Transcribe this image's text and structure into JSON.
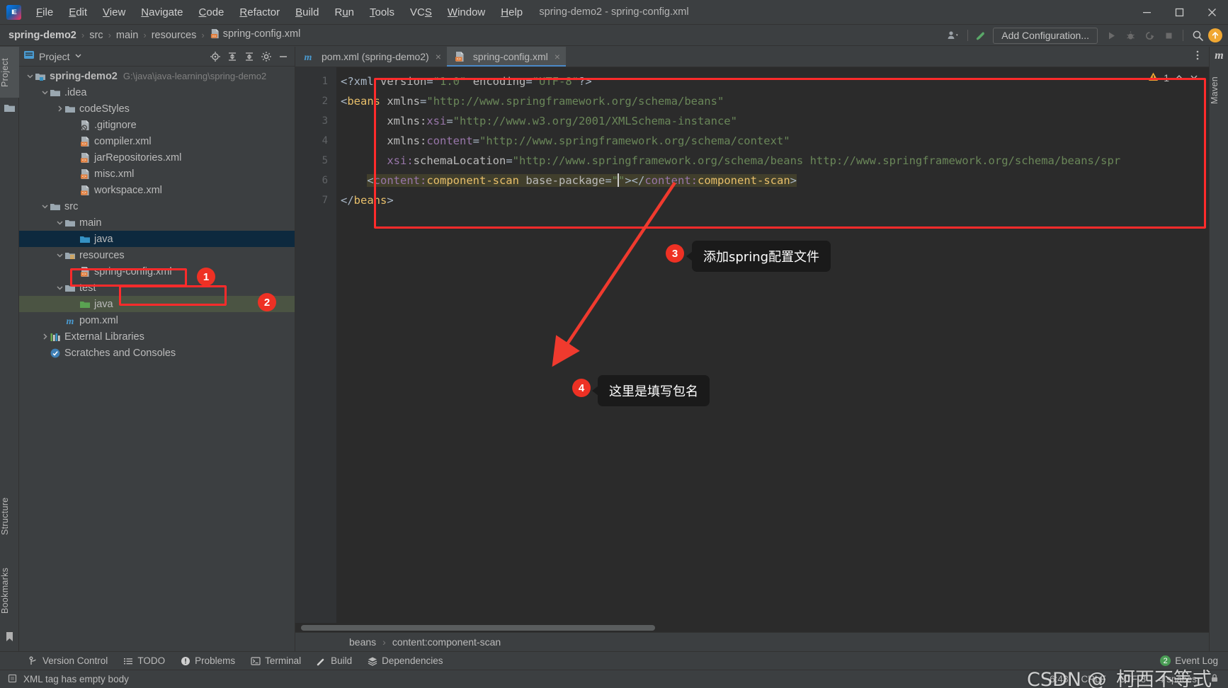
{
  "window": {
    "title": "spring-demo2 - spring-config.xml",
    "logo_text": "IE",
    "minimize_icon": "minimize-icon",
    "maximize_icon": "maximize-icon",
    "close_icon": "close-icon"
  },
  "menubar": {
    "items": [
      {
        "label": "File",
        "mnemonic": "F"
      },
      {
        "label": "Edit",
        "mnemonic": "E"
      },
      {
        "label": "View",
        "mnemonic": "V"
      },
      {
        "label": "Navigate",
        "mnemonic": "N"
      },
      {
        "label": "Code",
        "mnemonic": "C"
      },
      {
        "label": "Refactor",
        "mnemonic": "R"
      },
      {
        "label": "Build",
        "mnemonic": "B"
      },
      {
        "label": "Run",
        "mnemonic": "u"
      },
      {
        "label": "Tools",
        "mnemonic": "T"
      },
      {
        "label": "VCS",
        "mnemonic": "S"
      },
      {
        "label": "Window",
        "mnemonic": "W"
      },
      {
        "label": "Help",
        "mnemonic": "H"
      }
    ]
  },
  "navbar": {
    "breadcrumbs": [
      "spring-demo2",
      "src",
      "main",
      "resources",
      "spring-config.xml"
    ],
    "separator": "›",
    "add_configuration_label": "Add Configuration...",
    "icons": [
      "user-settings-icon",
      "hammer-build-icon",
      "run-icon",
      "debug-icon",
      "run-coverage-icon",
      "stop-icon",
      "search-icon",
      "update-arrow-icon"
    ]
  },
  "left_strip": {
    "tabs": [
      {
        "label": "Project",
        "icon": "project-folder-icon",
        "active": true
      },
      {
        "label": "Structure",
        "icon": "structure-icon",
        "active": false
      },
      {
        "label": "Bookmarks",
        "icon": "bookmark-icon",
        "active": false
      }
    ]
  },
  "right_strip": {
    "tabs": [
      {
        "label": "Maven",
        "icon": "maven-m-icon"
      }
    ]
  },
  "project_panel": {
    "title": "Project",
    "icons": [
      "project-icon",
      "chevron-down-icon",
      "locate-icon",
      "expand-all-icon",
      "collapse-all-icon",
      "gear-icon",
      "hide-icon"
    ],
    "tree": [
      {
        "depth": 0,
        "label": "spring-demo2",
        "path": "G:\\java\\java-learning\\spring-demo2",
        "icon": "module-icon",
        "arrow": "down",
        "bold": true,
        "state": "none"
      },
      {
        "depth": 1,
        "label": ".idea",
        "icon": "folder-icon",
        "arrow": "down",
        "bold": false,
        "state": "none"
      },
      {
        "depth": 2,
        "label": "codeStyles",
        "icon": "folder-icon",
        "arrow": "right",
        "bold": false,
        "state": "none"
      },
      {
        "depth": 3,
        "label": ".gitignore",
        "icon": "gitignore-file-icon",
        "arrow": "none",
        "bold": false,
        "state": "none"
      },
      {
        "depth": 3,
        "label": "compiler.xml",
        "icon": "xml-file-icon",
        "arrow": "none",
        "bold": false,
        "state": "none"
      },
      {
        "depth": 3,
        "label": "jarRepositories.xml",
        "icon": "xml-file-icon",
        "arrow": "none",
        "bold": false,
        "state": "none"
      },
      {
        "depth": 3,
        "label": "misc.xml",
        "icon": "xml-file-icon",
        "arrow": "none",
        "bold": false,
        "state": "none"
      },
      {
        "depth": 3,
        "label": "workspace.xml",
        "icon": "xml-file-icon",
        "arrow": "none",
        "bold": false,
        "state": "none"
      },
      {
        "depth": 1,
        "label": "src",
        "icon": "folder-icon",
        "arrow": "down",
        "bold": false,
        "state": "none"
      },
      {
        "depth": 2,
        "label": "main",
        "icon": "folder-icon",
        "arrow": "down",
        "bold": false,
        "state": "none"
      },
      {
        "depth": 3,
        "label": "java",
        "icon": "source-folder-icon",
        "arrow": "none",
        "bold": false,
        "state": "sel-blue"
      },
      {
        "depth": 2,
        "label": "resources",
        "icon": "resource-folder-icon",
        "arrow": "down",
        "bold": false,
        "state": "none"
      },
      {
        "depth": 3,
        "label": "spring-config.xml",
        "icon": "xml-file-icon",
        "arrow": "none",
        "bold": false,
        "state": "none"
      },
      {
        "depth": 2,
        "label": "test",
        "icon": "folder-icon",
        "arrow": "down",
        "bold": false,
        "state": "none"
      },
      {
        "depth": 3,
        "label": "java",
        "icon": "test-source-folder-icon",
        "arrow": "none",
        "bold": false,
        "state": "sel-green"
      },
      {
        "depth": 2,
        "label": "pom.xml",
        "icon": "maven-pom-icon",
        "arrow": "none",
        "bold": false,
        "state": "none"
      },
      {
        "depth": 1,
        "label": "External Libraries",
        "icon": "libraries-icon",
        "arrow": "right",
        "bold": false,
        "state": "none"
      },
      {
        "depth": 1,
        "label": "Scratches and Consoles",
        "icon": "scratches-icon",
        "arrow": "none",
        "bold": false,
        "state": "none"
      }
    ]
  },
  "editor": {
    "tabs": [
      {
        "label": "pom.xml (spring-demo2)",
        "icon": "maven-pom-icon",
        "active": false,
        "closable": true
      },
      {
        "label": "spring-config.xml",
        "icon": "xml-file-icon",
        "active": true,
        "closable": true
      }
    ],
    "more_icon": "more-vertical-icon",
    "inspection": {
      "icon": "warning-triangle-icon",
      "count": "1",
      "up_icon": "chevron-up-icon",
      "down_icon": "chevron-down-icon"
    },
    "line_numbers": [
      "1",
      "2",
      "3",
      "4",
      "5",
      "6",
      "7"
    ],
    "lines": [
      [
        {
          "t": "punc",
          "s": "<?xml "
        },
        {
          "t": "attr",
          "s": "version"
        },
        {
          "t": "punc",
          "s": "="
        },
        {
          "t": "val",
          "s": "\"1.0\""
        },
        {
          "t": "punc",
          "s": " "
        },
        {
          "t": "attr",
          "s": "encoding"
        },
        {
          "t": "punc",
          "s": "="
        },
        {
          "t": "val",
          "s": "\"UTF-8\""
        },
        {
          "t": "punc",
          "s": "?>"
        }
      ],
      [
        {
          "t": "punc",
          "s": "<"
        },
        {
          "t": "tag",
          "s": "beans"
        },
        {
          "t": "punc",
          "s": " "
        },
        {
          "t": "attr",
          "s": "xmlns"
        },
        {
          "t": "punc",
          "s": "="
        },
        {
          "t": "val",
          "s": "\"http://www.springframework.org/schema/beans\""
        }
      ],
      [
        {
          "t": "punc",
          "s": "       "
        },
        {
          "t": "attr",
          "s": "xmlns:"
        },
        {
          "t": "ns",
          "s": "xsi"
        },
        {
          "t": "punc",
          "s": "="
        },
        {
          "t": "val",
          "s": "\"http://www.w3.org/2001/XMLSchema-instance\""
        }
      ],
      [
        {
          "t": "punc",
          "s": "       "
        },
        {
          "t": "attr",
          "s": "xmlns:"
        },
        {
          "t": "ns",
          "s": "content"
        },
        {
          "t": "punc",
          "s": "="
        },
        {
          "t": "val",
          "s": "\"http://www.springframework.org/schema/context\""
        }
      ],
      [
        {
          "t": "punc",
          "s": "       "
        },
        {
          "t": "ns",
          "s": "xsi:"
        },
        {
          "t": "attr",
          "s": "schemaLocation"
        },
        {
          "t": "punc",
          "s": "="
        },
        {
          "t": "val",
          "s": "\"http://www.springframework.org/schema/beans http://www.springframework.org/schema/beans/spr"
        }
      ],
      [],
      [
        {
          "t": "punc",
          "s": "</"
        },
        {
          "t": "tag",
          "s": "beans"
        },
        {
          "t": "punc",
          "s": ">"
        }
      ]
    ],
    "line6": {
      "prefix": "    ",
      "open_punc": "<",
      "ns": "content:",
      "tag": "component-scan",
      "space": " ",
      "attr": "base-package",
      "eq": "=",
      "quote_open": "\"",
      "quote_close": "\"",
      "mid": "></",
      "close_ns": "content:",
      "close_tag": "component-scan",
      "close_punc": ">"
    },
    "breadcrumb": [
      "beans",
      "content:component-scan"
    ],
    "breadcrumb_sep": "›"
  },
  "toolwindow_bar": {
    "items": [
      {
        "label": "Version Control",
        "icon": "branch-icon"
      },
      {
        "label": "TODO",
        "icon": "todo-list-icon"
      },
      {
        "label": "Problems",
        "icon": "problems-icon"
      },
      {
        "label": "Terminal",
        "icon": "terminal-icon"
      },
      {
        "label": "Build",
        "icon": "hammer-build-icon"
      },
      {
        "label": "Dependencies",
        "icon": "dependencies-icon"
      }
    ],
    "event_log": {
      "label": "Event Log",
      "badge": "2"
    }
  },
  "statusbar": {
    "message": "XML tag has empty body",
    "message_icon": "inspection-icon",
    "caret_position": "6:43",
    "line_separator": "CRLF",
    "encoding": "UTF-8",
    "indent": "4 spaces",
    "lock_icon": "lock-icon"
  },
  "annotations": {
    "callouts": [
      {
        "num": "1",
        "tip": null
      },
      {
        "num": "2",
        "tip": null
      },
      {
        "num": "3",
        "tip": "添加spring配置文件"
      },
      {
        "num": "4",
        "tip": "这里是填写包名"
      }
    ],
    "highlight_color": "#ff2b2b",
    "watermark": "CSDN @_柯西不等式"
  }
}
